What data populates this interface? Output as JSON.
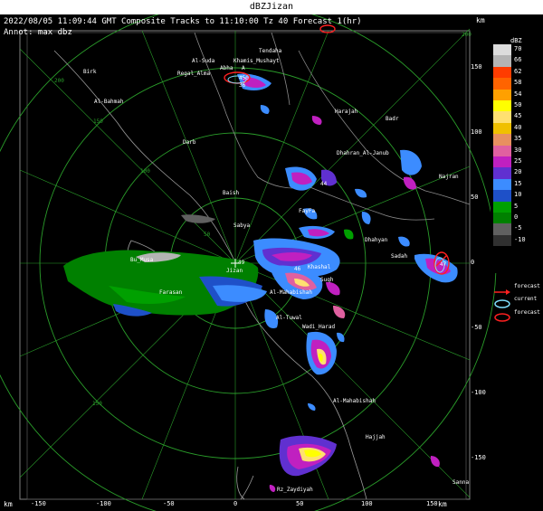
{
  "window": {
    "title": "dBZJizan"
  },
  "header": {
    "text": "2022/08/05 11:09:44 GMT Composite Tracks to 11:10:00 Tz 40 Forecast 1(hr)",
    "annot": "Annot: max dbz",
    "km_label": "km"
  },
  "legend": {
    "title": "dBZ",
    "levels": [
      {
        "label": "70",
        "color": "#dcdcdc"
      },
      {
        "label": "66",
        "color": "#b4b4b4"
      },
      {
        "label": "62",
        "color": "#ff3c00"
      },
      {
        "label": "58",
        "color": "#ff6400"
      },
      {
        "label": "54",
        "color": "#ffa000"
      },
      {
        "label": "50",
        "color": "#ffff00"
      },
      {
        "label": "45",
        "color": "#ffe070"
      },
      {
        "label": "40",
        "color": "#f0c000"
      },
      {
        "label": "35",
        "color": "#e89060"
      },
      {
        "label": "30",
        "color": "#e060a0"
      },
      {
        "label": "25",
        "color": "#c020c0"
      },
      {
        "label": "20",
        "color": "#6030d0"
      },
      {
        "label": "15",
        "color": "#3c8cff"
      },
      {
        "label": "10",
        "color": "#1e50c8"
      },
      {
        "label": "5",
        "color": "#00a000"
      },
      {
        "label": "0",
        "color": "#008000"
      },
      {
        "label": "-5",
        "color": "#606060"
      },
      {
        "label": "-10",
        "color": "#303030"
      }
    ],
    "symbols": [
      {
        "label": "forecast",
        "kind": "arrow",
        "color": "#ff2020"
      },
      {
        "label": "current",
        "kind": "ellipse",
        "color": "#80e0ff"
      },
      {
        "label": "forecast",
        "kind": "ellipse",
        "color": "#ff2020"
      }
    ]
  },
  "map": {
    "range_ring_labels": [
      "50",
      "100",
      "150",
      "200"
    ],
    "x_axis": {
      "label": "km",
      "ticks": [
        "-150",
        "-100",
        "-50",
        "0",
        "50",
        "100",
        "150"
      ]
    },
    "y_axis": {
      "label": "km",
      "ticks": [
        "150",
        "100",
        "50",
        "0",
        "-50",
        "-100",
        "-150"
      ]
    },
    "places": [
      {
        "name": "Tendaha"
      },
      {
        "name": "Al-Suda"
      },
      {
        "name": "Khamis_Mushayt"
      },
      {
        "name": "Abha"
      },
      {
        "name": "Regal_Alma"
      },
      {
        "name": "Birk"
      },
      {
        "name": "Al-Bahmah"
      },
      {
        "name": "Harajah"
      },
      {
        "name": "Badr"
      },
      {
        "name": "Darb"
      },
      {
        "name": "Dhahran_Al-Janub"
      },
      {
        "name": "Najran"
      },
      {
        "name": "Baish"
      },
      {
        "name": "FayFa"
      },
      {
        "name": "Sabya"
      },
      {
        "name": "Dhahyan"
      },
      {
        "name": "Sadah"
      },
      {
        "name": "Bu_Musa"
      },
      {
        "name": "Jizan"
      },
      {
        "name": "Khashal"
      },
      {
        "name": "Suqh"
      },
      {
        "name": "Farasan"
      },
      {
        "name": "Al-Mahabishah"
      },
      {
        "name": "Al-Tuwal"
      },
      {
        "name": "Wadi_Harad"
      },
      {
        "name": "Al-Mahabishah"
      },
      {
        "name": "Hajjah"
      },
      {
        "name": "Rz_Zaydiyah"
      },
      {
        "name": "Sanna"
      }
    ],
    "track_labels": [
      "A",
      "450",
      "36",
      "44",
      "46",
      "49",
      "47"
    ]
  }
}
